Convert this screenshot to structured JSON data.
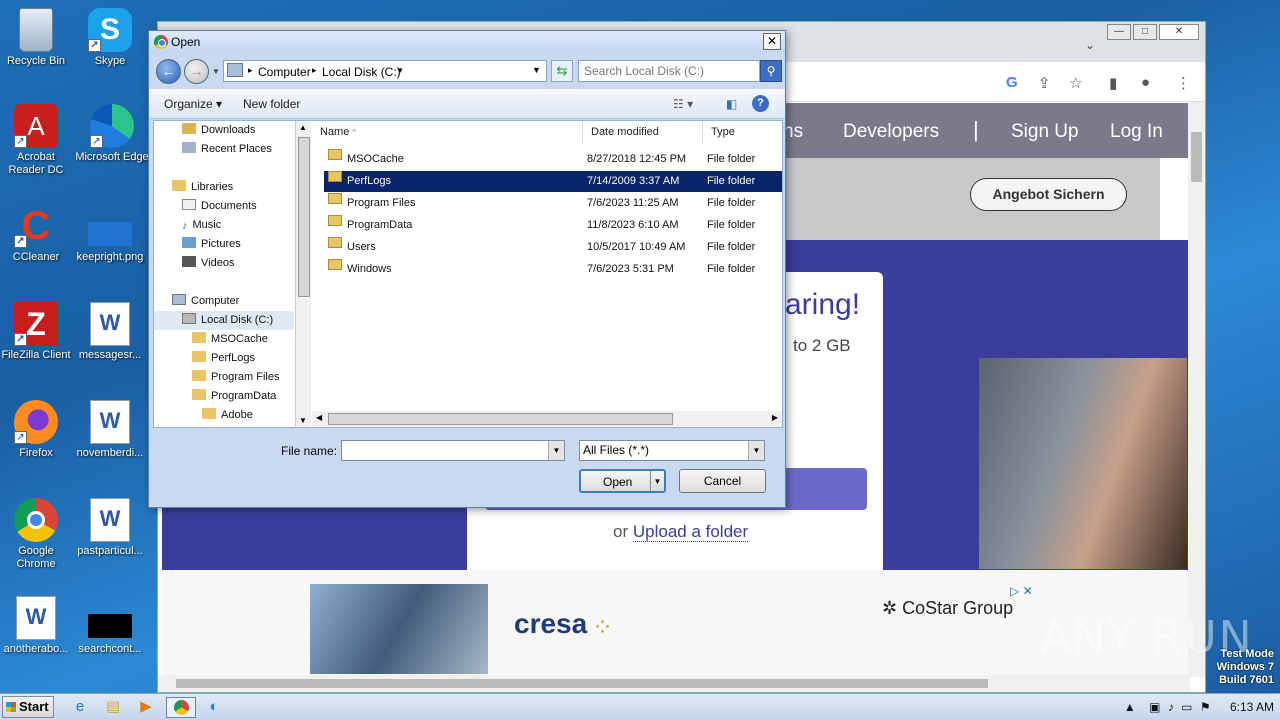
{
  "desktop": {
    "icons": [
      {
        "label": "Recycle Bin",
        "icon": "recycle-bin-icon"
      },
      {
        "label": "Skype",
        "icon": "skype-icon"
      },
      {
        "label": "Acrobat Reader DC",
        "icon": "acrobat-icon"
      },
      {
        "label": "Microsoft Edge",
        "icon": "edge-icon"
      },
      {
        "label": "CCleaner",
        "icon": "ccleaner-icon"
      },
      {
        "label": "keepright.png",
        "icon": "image-file-icon"
      },
      {
        "label": "FileZilla Client",
        "icon": "filezilla-icon"
      },
      {
        "label": "messagesr...",
        "icon": "word-doc-icon"
      },
      {
        "label": "Firefox",
        "icon": "firefox-icon"
      },
      {
        "label": "novemberdi...",
        "icon": "word-doc-icon"
      },
      {
        "label": "Google Chrome",
        "icon": "chrome-icon"
      },
      {
        "label": "pastparticul...",
        "icon": "word-doc-icon"
      },
      {
        "label": "anotherabo...",
        "icon": "word-doc-icon"
      },
      {
        "label": "searchcont...",
        "icon": "image-file-icon"
      }
    ]
  },
  "browser": {
    "nav_links": [
      "ns",
      "Developers",
      "Sign Up",
      "Log In"
    ],
    "angebot_button": "Angebot Sichern",
    "hero_title": "aring!",
    "hero_sub": "to 2 GB",
    "upload_prefix": "or",
    "upload_link": "Upload a folder",
    "ad": {
      "brand1": "cresa",
      "brand2": "CoStar Group",
      "ad_marker": "▷ ✕"
    },
    "toolbar_icons": [
      "google-icon",
      "share-icon",
      "star-icon",
      "sidebar-icon",
      "profile-icon",
      "menu-icon"
    ]
  },
  "dialog": {
    "title": "Open",
    "path": [
      "Computer",
      "Local Disk (C:)"
    ],
    "search_placeholder": "Search Local Disk (C:)",
    "organize_label": "Organize",
    "new_folder_label": "New folder",
    "nav_items": [
      {
        "label": "Downloads",
        "indent": 1
      },
      {
        "label": "Recent Places",
        "indent": 1
      },
      {
        "label": "Libraries",
        "indent": 0
      },
      {
        "label": "Documents",
        "indent": 1
      },
      {
        "label": "Music",
        "indent": 1
      },
      {
        "label": "Pictures",
        "indent": 1
      },
      {
        "label": "Videos",
        "indent": 1
      },
      {
        "label": "Computer",
        "indent": 0
      },
      {
        "label": "Local Disk (C:)",
        "indent": 1,
        "selected": true
      },
      {
        "label": "MSOCache",
        "indent": 2
      },
      {
        "label": "PerfLogs",
        "indent": 2
      },
      {
        "label": "Program Files",
        "indent": 2
      },
      {
        "label": "ProgramData",
        "indent": 2
      },
      {
        "label": "Adobe",
        "indent": 3
      }
    ],
    "columns": {
      "name": "Name",
      "date": "Date modified",
      "type": "Type"
    },
    "files": [
      {
        "name": "MSOCache",
        "date": "8/27/2018 12:45 PM",
        "type": "File folder",
        "locked": true
      },
      {
        "name": "PerfLogs",
        "date": "7/14/2009 3:37 AM",
        "type": "File folder",
        "selected": true
      },
      {
        "name": "Program Files",
        "date": "7/6/2023 11:25 AM",
        "type": "File folder"
      },
      {
        "name": "ProgramData",
        "date": "11/8/2023 6:10 AM",
        "type": "File folder"
      },
      {
        "name": "Users",
        "date": "10/5/2017 10:49 AM",
        "type": "File folder"
      },
      {
        "name": "Windows",
        "date": "7/6/2023 5:31 PM",
        "type": "File folder"
      }
    ],
    "file_name_label": "File name:",
    "file_name_value": "",
    "file_type": "All Files (*.*)",
    "open_button": "Open",
    "cancel_button": "Cancel"
  },
  "taskbar": {
    "start_label": "Start",
    "apps": [
      "ie-icon",
      "explorer-icon",
      "media-player-icon",
      "chrome-icon",
      "edge-icon"
    ],
    "clock": "6:13 AM"
  },
  "watermark": {
    "line1": "Test Mode",
    "line2": "Windows 7",
    "line3": "Build 7601",
    "brand": "ANY RUN"
  }
}
